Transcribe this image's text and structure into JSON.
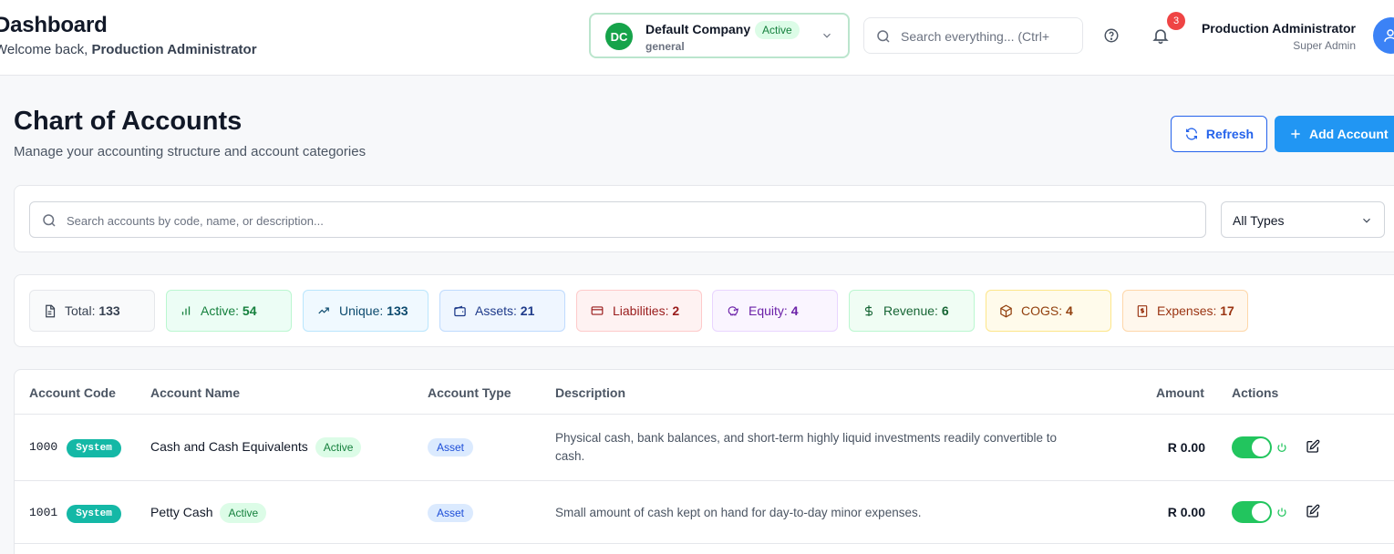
{
  "header": {
    "title": "Dashboard",
    "welcome_prefix": "Welcome back, ",
    "welcome_user": "Production Administrator",
    "company": {
      "initials": "DC",
      "name": "Default Company",
      "status": "Active",
      "sub": "general"
    },
    "search_placeholder": "Search everything... (Ctrl+",
    "notifications_count": "3",
    "user": {
      "name": "Production Administrator",
      "role": "Super Admin"
    }
  },
  "page": {
    "title": "Chart of Accounts",
    "subtitle": "Manage your accounting structure and account categories",
    "refresh_label": "Refresh",
    "add_label": "Add Account"
  },
  "filters": {
    "search_placeholder": "Search accounts by code, name, or description...",
    "type_value": "All Types"
  },
  "stats": [
    {
      "label": "Total:",
      "value": "133",
      "icon": "document-icon",
      "color": "#374151"
    },
    {
      "label": "Active:",
      "value": "54",
      "icon": "bar-chart-icon",
      "color": "#15803d"
    },
    {
      "label": "Unique:",
      "value": "133",
      "icon": "trending-up-icon",
      "color": "#0c4a6e"
    },
    {
      "label": "Assets:",
      "value": "21",
      "icon": "wallet-icon",
      "color": "#1e3a8a"
    },
    {
      "label": "Liabilities:",
      "value": "2",
      "icon": "credit-card-icon",
      "color": "#991b1b"
    },
    {
      "label": "Equity:",
      "value": "4",
      "icon": "piggy-bank-icon",
      "color": "#6b21a8"
    },
    {
      "label": "Revenue:",
      "value": "6",
      "icon": "dollar-icon",
      "color": "#166534"
    },
    {
      "label": "COGS:",
      "value": "4",
      "icon": "package-icon",
      "color": "#92400e"
    },
    {
      "label": "Expenses:",
      "value": "17",
      "icon": "receipt-icon",
      "color": "#9a3412"
    }
  ],
  "table": {
    "columns": {
      "code": "Account Code",
      "name": "Account Name",
      "type": "Account Type",
      "description": "Description",
      "amount": "Amount",
      "actions": "Actions"
    },
    "rows": [
      {
        "code": "1000",
        "system": "System",
        "name": "Cash and Cash Equivalents",
        "status": "Active",
        "type": "Asset",
        "description": "Physical cash, bank balances, and short-term highly liquid investments readily convertible to cash.",
        "amount": "R 0.00"
      },
      {
        "code": "1001",
        "system": "System",
        "name": "Petty Cash",
        "status": "Active",
        "type": "Asset",
        "description": "Small amount of cash kept on hand for day-to-day minor expenses.",
        "amount": "R 0.00"
      }
    ]
  }
}
